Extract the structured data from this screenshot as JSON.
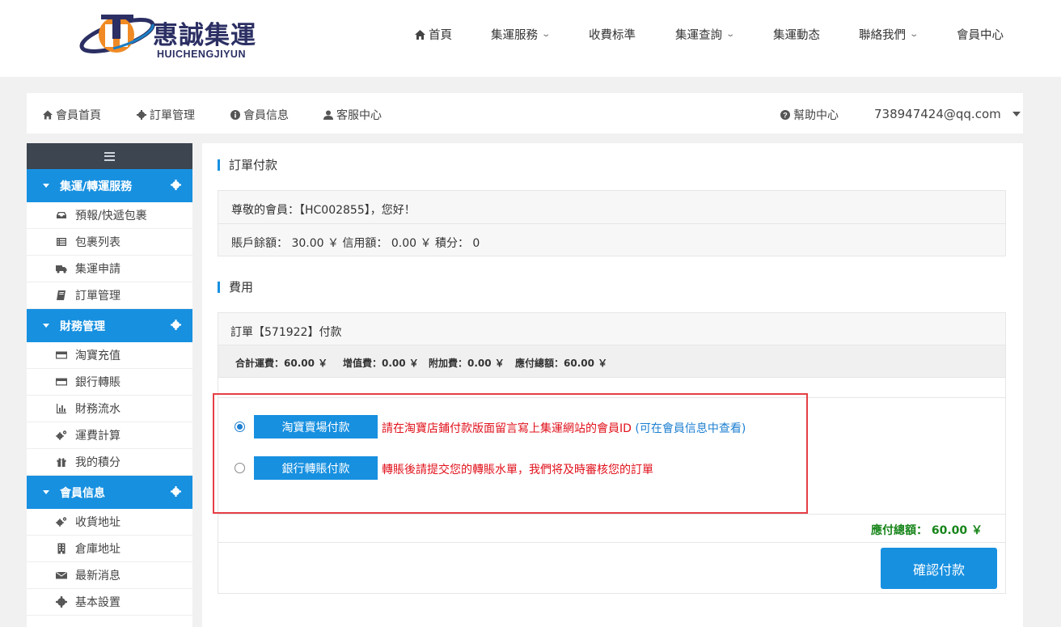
{
  "brand": {
    "name_cn": "惠誠集運",
    "name_en": "HUICHENGJIYUN",
    "primary_color": "#1790e0",
    "logo_orange": "#f08a24",
    "logo_navy": "#2b2f63"
  },
  "nav": {
    "home": "首頁",
    "services": "集運服務",
    "pricing": "收費标準",
    "tracking": "集運查詢",
    "news": "集運動态",
    "contact": "聯絡我們",
    "member": "會員中心"
  },
  "member_bar": {
    "home": "會員首頁",
    "orders": "訂單管理",
    "info": "會員信息",
    "support": "客服中心",
    "help": "幫助中心",
    "account": "738947424@qq.com"
  },
  "sidebar": {
    "groups": [
      {
        "title": "集運/轉運服務",
        "items": [
          {
            "label": "預報/快遞包裹",
            "icon": "inbox-icon"
          },
          {
            "label": "包裹列表",
            "icon": "list-icon"
          },
          {
            "label": "集運申請",
            "icon": "truck-icon"
          },
          {
            "label": "訂單管理",
            "icon": "book-icon"
          }
        ]
      },
      {
        "title": "財務管理",
        "items": [
          {
            "label": "淘寶充值",
            "icon": "credit-card-icon"
          },
          {
            "label": "銀行轉賬",
            "icon": "credit-card-icon"
          },
          {
            "label": "財務流水",
            "icon": "bar-chart-icon"
          },
          {
            "label": "運費計算",
            "icon": "gears-icon"
          },
          {
            "label": "我的積分",
            "icon": "gift-icon"
          }
        ]
      },
      {
        "title": "會員信息",
        "items": [
          {
            "label": "收貨地址",
            "icon": "gears-icon"
          },
          {
            "label": "倉庫地址",
            "icon": "building-icon"
          },
          {
            "label": "最新消息",
            "icon": "envelope-icon"
          },
          {
            "label": "基本設置",
            "icon": "gear-icon"
          }
        ]
      }
    ]
  },
  "main": {
    "order_payment_title": "訂單付款",
    "greeting": "尊敬的會員：【HC002855】，您好！",
    "balance_line": "賬戶餘額： 30.00 ￥   信用額： 0.00 ￥   積分： 0",
    "fees_title": "費用",
    "order_header": "訂單【571922】付款",
    "fees": {
      "shipping": "合計運費：60.00 ￥",
      "value_added": "增值費：0.00 ￥",
      "extra": "附加費：0.00 ￥",
      "total": "應付總額：60.00 ￥"
    },
    "payment_options": [
      {
        "label": "淘寶賣場付款",
        "note": "請在淘寶店鋪付款版面留言寫上集運網站的會員ID",
        "note_link": "(可在會員信息中查看)",
        "selected": true
      },
      {
        "label": "銀行轉賬付款",
        "note": "轉賬後請提交您的轉賬水單，我們将及時審核您的訂單",
        "note_link": "",
        "selected": false
      }
    ],
    "total_label": "應付總額：  60.00 ￥",
    "confirm_label": "確認付款"
  }
}
